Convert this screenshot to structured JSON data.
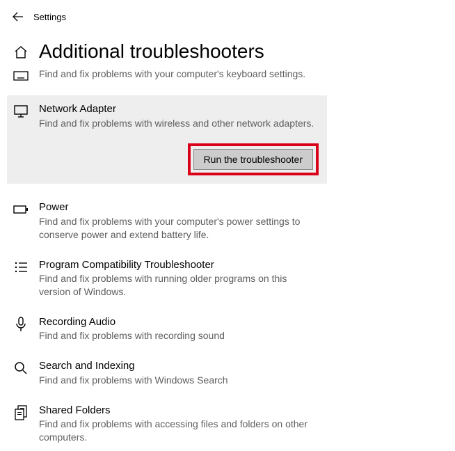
{
  "header": {
    "app_title": "Settings",
    "page_title": "Additional troubleshooters"
  },
  "items": {
    "keyboard": {
      "desc": "Find and fix problems with your computer's keyboard settings."
    },
    "network": {
      "title": "Network Adapter",
      "desc": "Find and fix problems with wireless and other network adapters.",
      "run_label": "Run the troubleshooter"
    },
    "power": {
      "title": "Power",
      "desc": "Find and fix problems with your computer's power settings to conserve power and extend battery life."
    },
    "compat": {
      "title": "Program Compatibility Troubleshooter",
      "desc": "Find and fix problems with running older programs on this version of Windows."
    },
    "recording": {
      "title": "Recording Audio",
      "desc": "Find and fix problems with recording sound"
    },
    "search": {
      "title": "Search and Indexing",
      "desc": "Find and fix problems with Windows Search"
    },
    "shared": {
      "title": "Shared Folders",
      "desc": "Find and fix problems with accessing files and folders on other computers."
    }
  }
}
